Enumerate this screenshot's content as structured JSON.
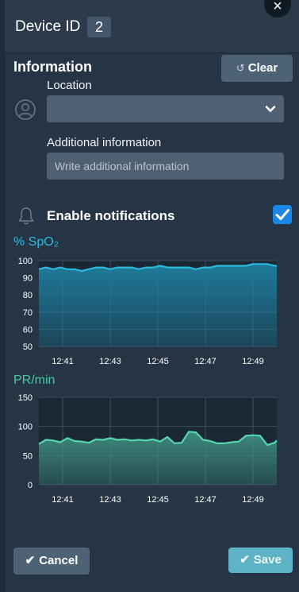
{
  "header": {
    "title": "Device ID",
    "device_number": "2",
    "close_label": "×"
  },
  "information": {
    "title": "Information",
    "clear_label": "Clear",
    "clear_icon": "↺",
    "location_label": "Location",
    "location_value": "",
    "additional_label": "Additional information",
    "additional_placeholder": "Write additional information",
    "additional_value": ""
  },
  "notifications": {
    "label": "Enable notifications",
    "enabled": true
  },
  "footer": {
    "cancel_label": "Cancel",
    "save_label": "Save",
    "check_icon": "✔"
  },
  "colors": {
    "spo2_line": "#2bb8dc",
    "spo2_fill": "#1e7fa0",
    "pr_line": "#55d6ad",
    "pr_fill": "#3e8f82",
    "checkbox": "#1b86e4",
    "save": "#5fb3c6"
  },
  "chart_data": [
    {
      "type": "area",
      "title": "% SpO₂",
      "ylim": [
        50,
        100
      ],
      "yticks": [
        "100",
        "90",
        "80",
        "70",
        "60",
        "50"
      ],
      "ytick_values": [
        100,
        90,
        80,
        70,
        60,
        50
      ],
      "xticks": [
        "12:41",
        "12:43",
        "12:45",
        "12:47",
        "12:49"
      ],
      "x_range": [
        0,
        10
      ],
      "xtick_positions": [
        1,
        3,
        5,
        7,
        9
      ],
      "grid": true,
      "series": [
        {
          "x": [
            0,
            0.3,
            0.6,
            0.9,
            1.2,
            1.5,
            1.8,
            2.1,
            2.4,
            2.7,
            3.0,
            3.3,
            3.6,
            3.9,
            4.2,
            4.5,
            4.8,
            5.1,
            5.4,
            5.7,
            6.0,
            6.3,
            6.6,
            6.9,
            7.2,
            7.5,
            7.8,
            8.1,
            8.4,
            8.7,
            9.0,
            9.3,
            9.6,
            9.9,
            10
          ],
          "values": [
            95,
            96,
            95,
            96,
            95,
            95,
            94,
            95,
            96,
            96,
            95,
            96,
            96,
            96,
            95,
            96,
            96,
            97,
            96,
            96,
            96,
            96,
            95,
            96,
            96,
            97,
            97,
            97,
            97,
            97,
            98,
            98,
            98,
            97,
            97
          ]
        }
      ]
    },
    {
      "type": "area",
      "title": "PR/min",
      "ylim": [
        0,
        150
      ],
      "yticks": [
        "150",
        "100",
        "50",
        "0"
      ],
      "ytick_values": [
        150,
        100,
        50,
        0
      ],
      "xticks": [
        "12:41",
        "12:43",
        "12:45",
        "12:47",
        "12:49"
      ],
      "x_range": [
        0,
        10
      ],
      "xtick_positions": [
        1,
        3,
        5,
        7,
        9
      ],
      "grid": true,
      "series": [
        {
          "x": [
            0,
            0.3,
            0.6,
            0.9,
            1.2,
            1.5,
            1.8,
            2.1,
            2.4,
            2.7,
            3.0,
            3.3,
            3.6,
            3.9,
            4.2,
            4.5,
            4.8,
            5.1,
            5.4,
            5.7,
            6.0,
            6.3,
            6.6,
            6.9,
            7.2,
            7.5,
            7.8,
            8.1,
            8.4,
            8.7,
            9.0,
            9.3,
            9.6,
            9.9,
            10
          ],
          "values": [
            70,
            77,
            76,
            73,
            80,
            75,
            74,
            72,
            78,
            77,
            80,
            77,
            78,
            76,
            77,
            76,
            78,
            74,
            82,
            71,
            72,
            91,
            90,
            77,
            75,
            71,
            71,
            73,
            74,
            84,
            85,
            84,
            68,
            72,
            76
          ]
        }
      ]
    }
  ]
}
